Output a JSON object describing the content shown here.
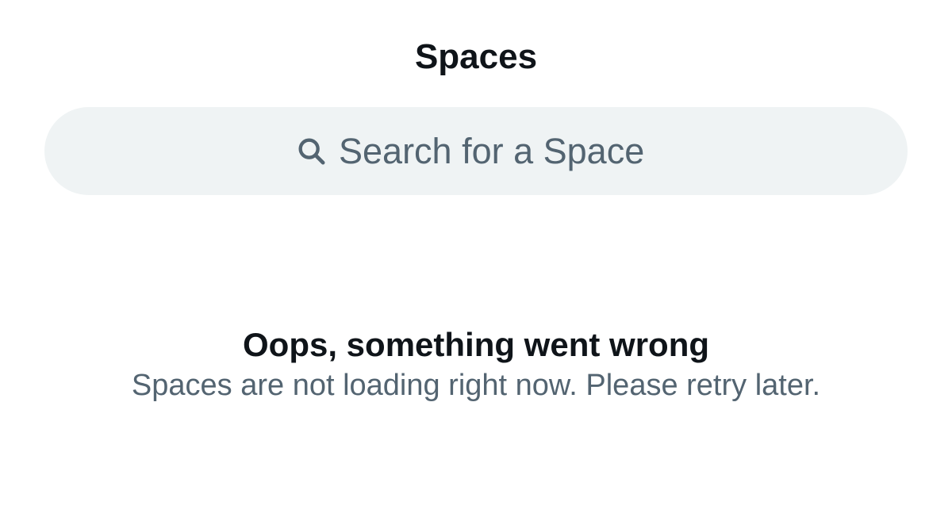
{
  "header": {
    "title": "Spaces"
  },
  "search": {
    "icon": "search-icon",
    "placeholder": "Search for a Space",
    "value": ""
  },
  "error": {
    "title": "Oops, something went wrong",
    "message": "Spaces are not loading right now. Please retry later."
  },
  "colors": {
    "primary_text": "#0f1419",
    "secondary_text": "#536471",
    "search_background": "#eff3f4",
    "background": "#ffffff"
  }
}
